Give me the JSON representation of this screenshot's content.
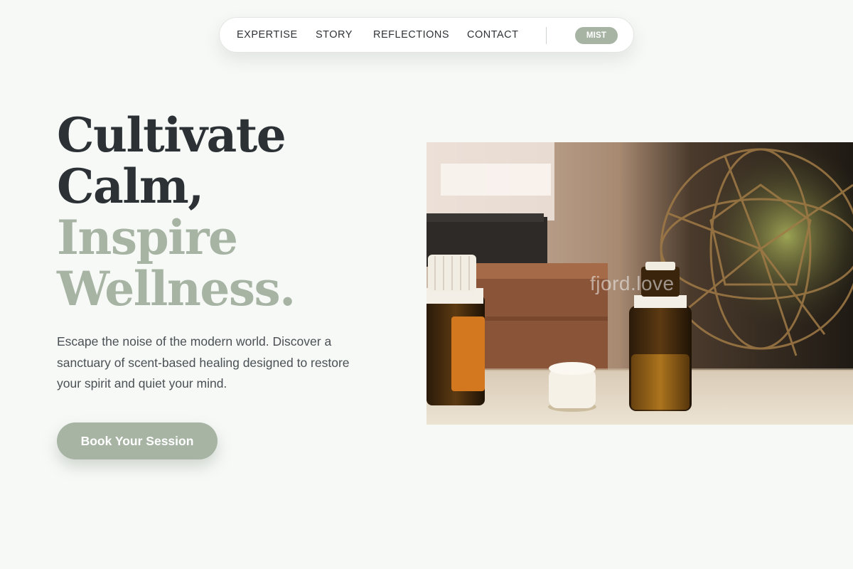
{
  "nav": {
    "items": [
      {
        "label": "EXPERTISE"
      },
      {
        "label": "STORY"
      },
      {
        "label": "REFLECTIONS"
      },
      {
        "label": "CONTACT"
      }
    ],
    "theme_pill": "MIST"
  },
  "hero": {
    "headline_line1": "Cultivate",
    "headline_line2": "Calm,",
    "headline_line3": "Inspire",
    "headline_line4": "Wellness.",
    "lede": "Escape the noise of the modern world. Discover a sanctuary of scent-based healing designed to restore your spirit and quiet your mind.",
    "cta_label": "Book Your Session",
    "image_watermark": "fjord.love"
  },
  "colors": {
    "background": "#f7f9f7",
    "dark_text": "#2b3134",
    "sage_accent": "#a7b4a4",
    "body_text": "#4a5054"
  },
  "icons": {
    "hero_image": "essential-oil-bottles-photo"
  }
}
